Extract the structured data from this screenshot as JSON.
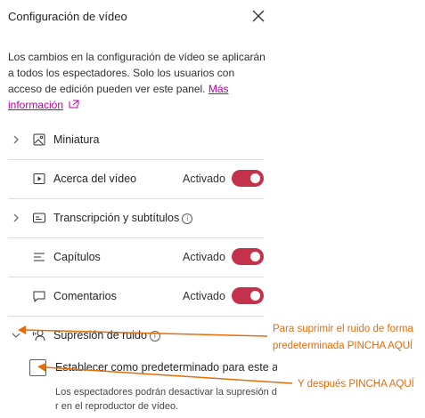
{
  "panel": {
    "title": "Configuración de vídeo",
    "description": "Los cambios en la configuración de vídeo se aplicarán a todos los espectadores. Solo los usuarios con acceso de edición pueden ver este panel.",
    "more_info_link": "Más información"
  },
  "settings": {
    "thumbnail": {
      "label": "Miniatura",
      "icon": "image-icon"
    },
    "about": {
      "label": "Acerca del vídeo",
      "state": "Activado",
      "on": true,
      "icon": "play-icon"
    },
    "transcript": {
      "label": "Transcripción y subtítulos",
      "icon": "captions-icon"
    },
    "chapters": {
      "label": "Capítulos",
      "state": "Activado",
      "on": true,
      "icon": "list-icon"
    },
    "comments": {
      "label": "Comentarios",
      "state": "Activado",
      "on": true,
      "icon": "comment-icon"
    },
    "noise": {
      "label": "Supresión de ruido",
      "icon": "noise-icon",
      "expanded": true
    }
  },
  "noise_option": {
    "checkbox_label": "Establecer como predeterminado para este a",
    "checked": false,
    "description": "Los espectadores podrán desactivar la supresión de r en el reproductor de vídeo."
  },
  "annotations": {
    "first_line1": "Para suprimir el ruido de forma",
    "first_line2": "predeterminada PINCHA AQUÍ",
    "second": "Y después PINCHA AQUÍ",
    "color": "#e46c0a"
  },
  "colors": {
    "toggle_on": "#c4314b",
    "link": "#b4009e"
  }
}
